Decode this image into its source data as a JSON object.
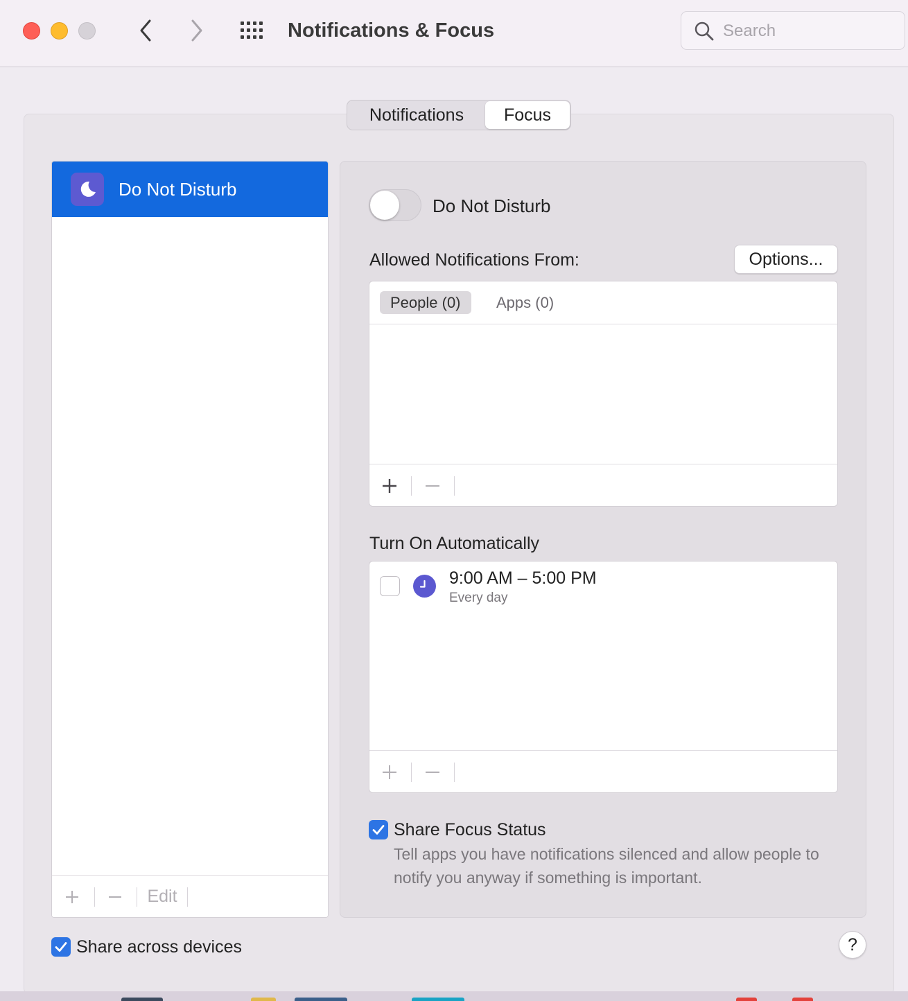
{
  "window": {
    "title": "Notifications & Focus",
    "search_placeholder": "Search"
  },
  "segmented": {
    "tabs": [
      {
        "label": "Notifications",
        "active": false
      },
      {
        "label": "Focus",
        "active": true
      }
    ]
  },
  "focus_list": {
    "items": [
      {
        "label": "Do Not Disturb",
        "icon": "moon-icon",
        "selected": true
      }
    ],
    "toolbar": {
      "add": "+",
      "remove": "−",
      "edit": "Edit"
    }
  },
  "detail": {
    "toggle_label": "Do Not Disturb",
    "toggle_on": false,
    "allowed_label": "Allowed Notifications From:",
    "options_button": "Options...",
    "subtabs": [
      {
        "label": "People (0)",
        "active": true
      },
      {
        "label": "Apps (0)",
        "active": false
      }
    ],
    "allowed_toolbar": {
      "add": "+",
      "remove": "−"
    },
    "turn_on_label": "Turn On Automatically",
    "schedules": [
      {
        "time": "9:00 AM – 5:00 PM",
        "days": "Every day",
        "enabled": false,
        "icon": "clock-icon"
      }
    ],
    "schedule_toolbar": {
      "add": "+",
      "remove": "−"
    },
    "share_focus_status": {
      "label": "Share Focus Status",
      "checked": true,
      "description": "Tell apps you have notifications silenced and allow people to notify you anyway if something is important."
    }
  },
  "footer": {
    "share_across_devices": {
      "label": "Share across devices",
      "checked": true
    },
    "help": "?"
  },
  "colors": {
    "accent": "#1369de",
    "focus_icon_bg": "#5d5ad1",
    "checkbox_blue": "#2d74e4"
  }
}
